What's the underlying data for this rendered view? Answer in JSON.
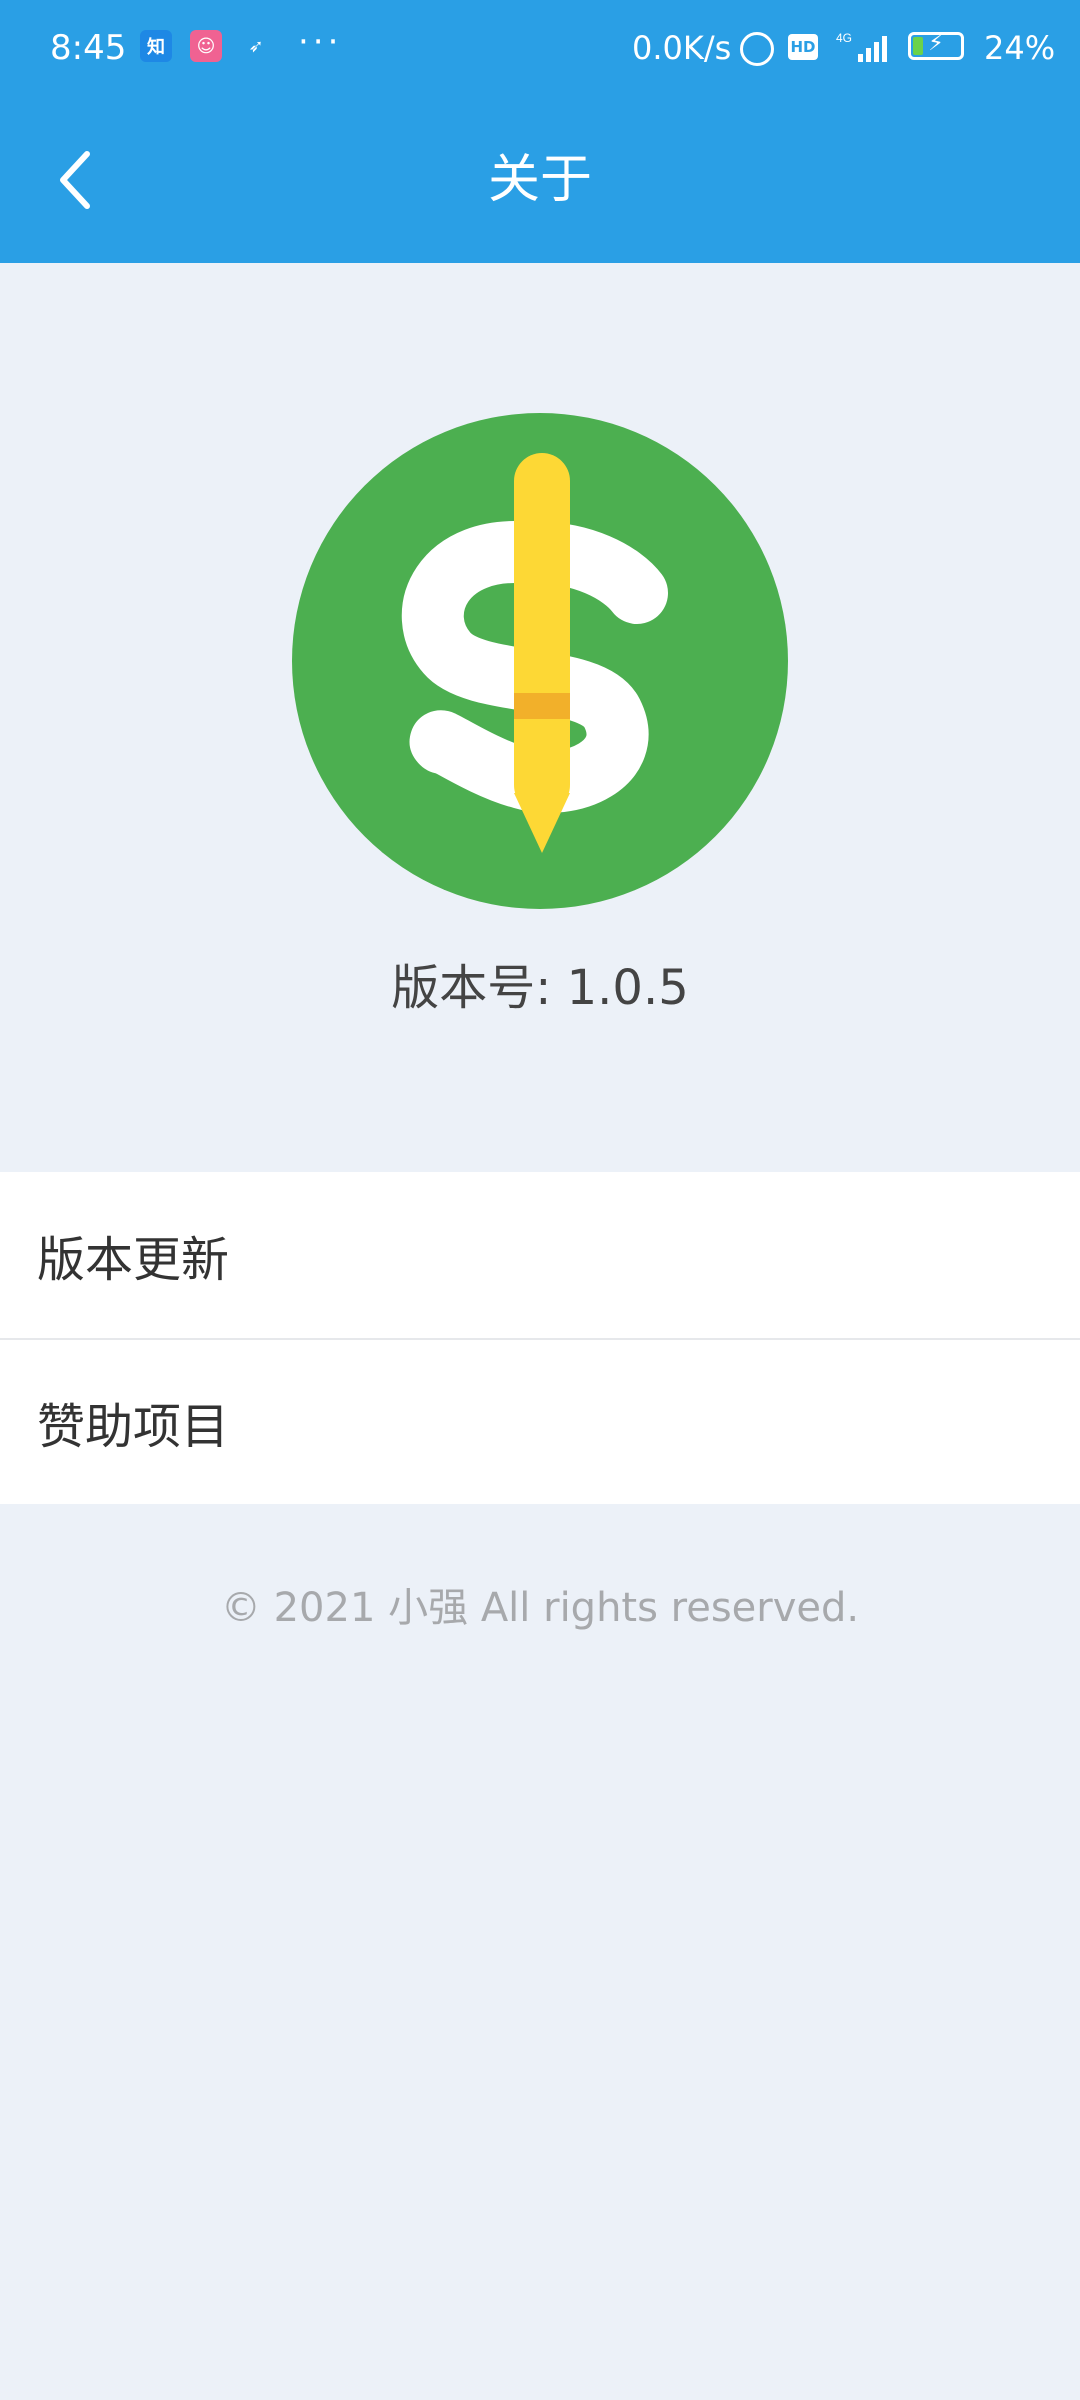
{
  "status_bar": {
    "time": "8:45",
    "notification_icons": [
      "zhihu-icon",
      "face-app-icon",
      "bird-app-icon"
    ],
    "more": "···",
    "network_speed": "0.0K/s",
    "indicators": [
      "alarm-icon",
      "hd-icon",
      "signal-4g-icon",
      "battery-charging-icon"
    ],
    "battery_percent": "24%"
  },
  "header": {
    "title": "关于",
    "back_icon": "chevron-left-icon",
    "background_color": "#2A9FE5"
  },
  "app": {
    "logo_icon": "dollar-pencil-logo",
    "version_label": "版本号: 1.0.5"
  },
  "menu": {
    "items": [
      {
        "label": "版本更新"
      },
      {
        "label": "赞助项目"
      }
    ]
  },
  "footer": {
    "copyright": "© 2021 小强 All rights reserved."
  },
  "colors": {
    "page_background": "#ECF1F8",
    "logo_green": "#4CAF50",
    "pencil_yellow": "#FDD835"
  }
}
